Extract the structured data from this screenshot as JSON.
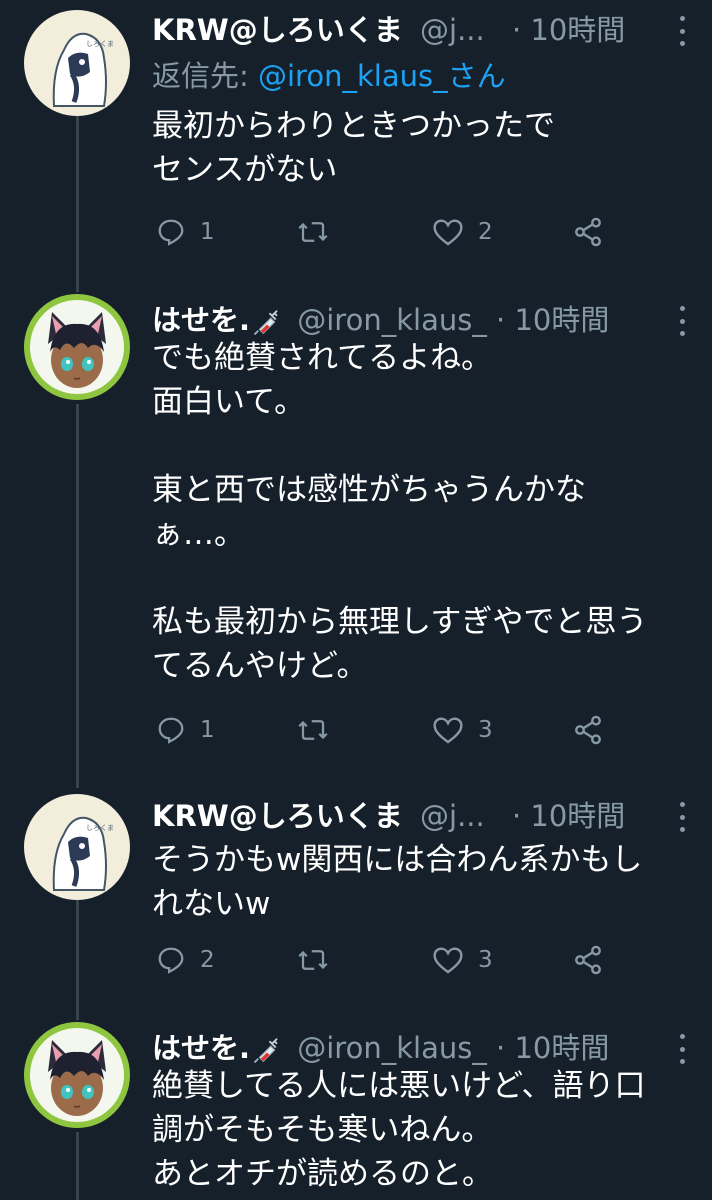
{
  "tweets": [
    {
      "name": "KRW@しろいくま",
      "handle": "@j...",
      "time": "10時間",
      "reply_prefix": "返信先: ",
      "reply_mention": "@iron_klaus_さん",
      "text": "最初からわりときつかったで\nセンスがない",
      "replies": "1",
      "retweets": "",
      "likes": "2",
      "avatar": "bear-avatar"
    },
    {
      "name": "はせを.",
      "handle": "@iron_klaus_",
      "time": "10時間",
      "text": "でも絶賛されてるよね。\n面白いて。\n\n東と西では感性がちゃうんかな\nぁ…。\n\n私も最初から無理しすぎやでと思う\nてるんやけど。",
      "replies": "1",
      "retweets": "",
      "likes": "3",
      "avatar": "catboy-avatar"
    },
    {
      "name": "KRW@しろいくま",
      "handle": "@j...",
      "time": "10時間",
      "text": "そうかもw関西には合わん系かもし\nれないw",
      "replies": "2",
      "retweets": "",
      "likes": "3",
      "avatar": "bear-avatar"
    },
    {
      "name": "はせを.",
      "handle": "@iron_klaus_",
      "time": "10時間",
      "text": "絶賛してる人には悪いけど、語り口\n調がそもそも寒いねん。\nあとオチが読めるのと。",
      "avatar": "catboy-avatar"
    }
  ],
  "separator": " · ",
  "colors": {
    "background": "#15202b",
    "secondary_text": "#8899a6",
    "link": "#1da1f2",
    "thread_line": "#38444d"
  }
}
